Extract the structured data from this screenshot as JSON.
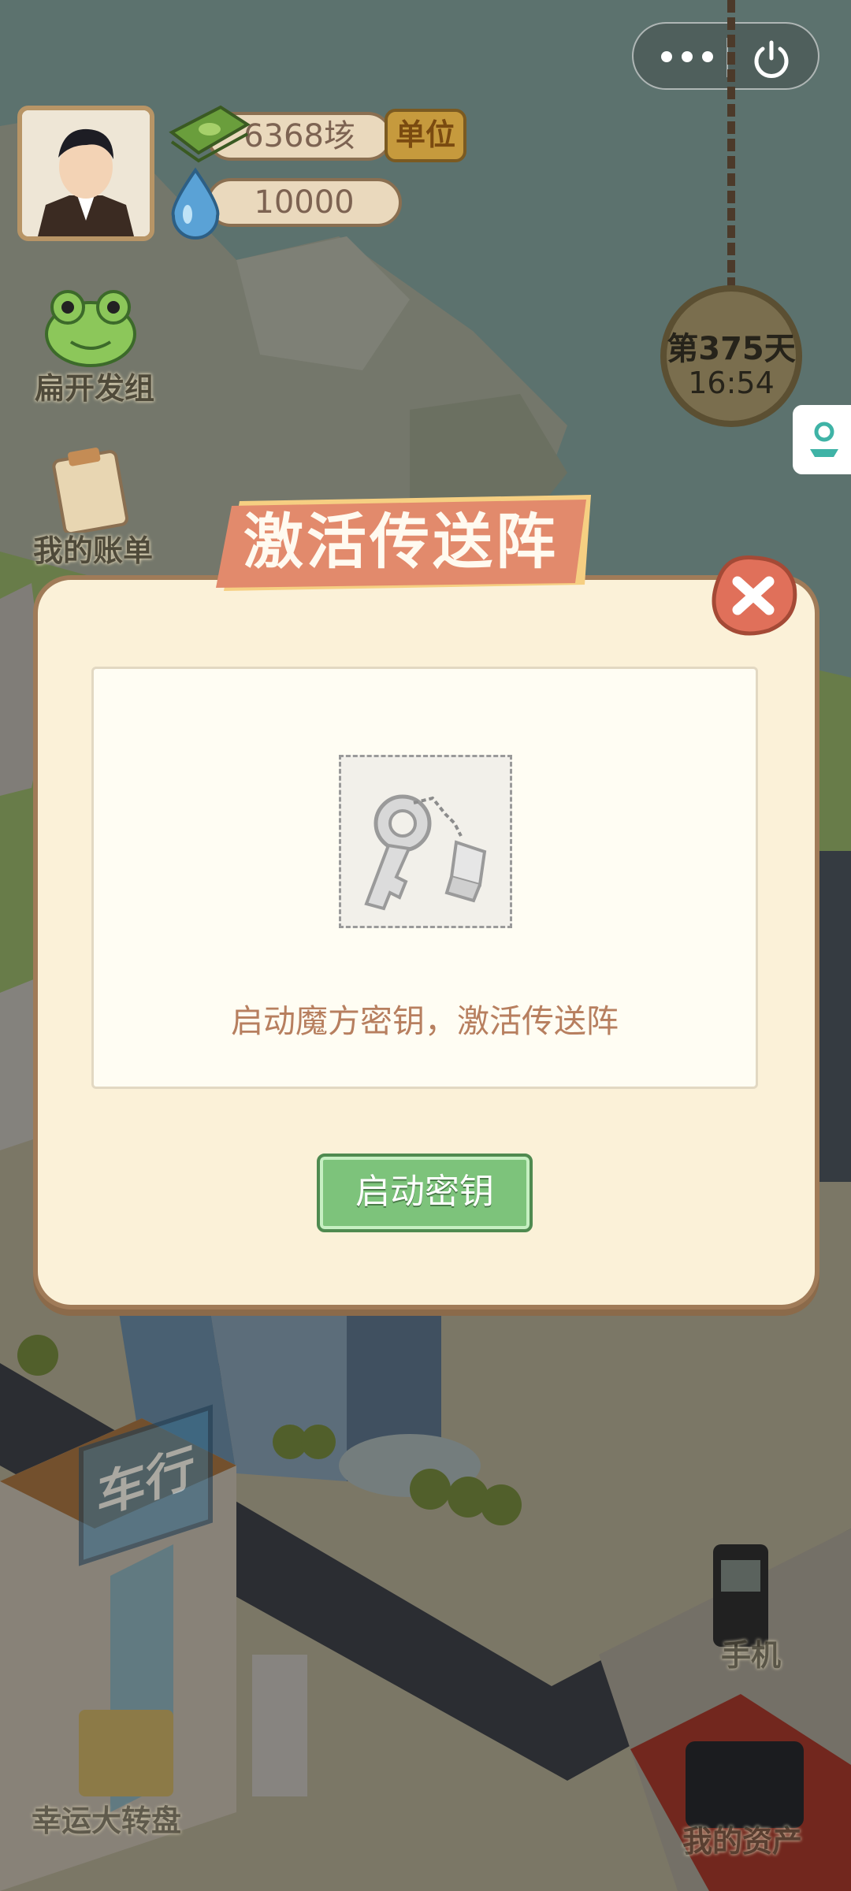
{
  "hud": {
    "money_value": "6368垓",
    "unit_button": "单位",
    "water_value": "10000"
  },
  "side_menu": {
    "frog_label": "扁开发组",
    "bill_label": "我的账单"
  },
  "clock": {
    "day": "第375天",
    "time": "16:54"
  },
  "dialog": {
    "title": "激活传送阵",
    "description": "启动魔方密钥，激活传送阵",
    "start_button": "启动密钥"
  },
  "scene": {
    "car_shop_sign": "车行",
    "lucky_wheel_label": "幸运大转盘",
    "phone_label": "手机",
    "assets_label": "我的资产"
  },
  "colors": {
    "dialog_bg": "#fbf1d8",
    "title_tab": "#e28a6c",
    "close_button": "#e0705a",
    "start_button": "#7dc37b",
    "description_text": "#b77f5f"
  }
}
